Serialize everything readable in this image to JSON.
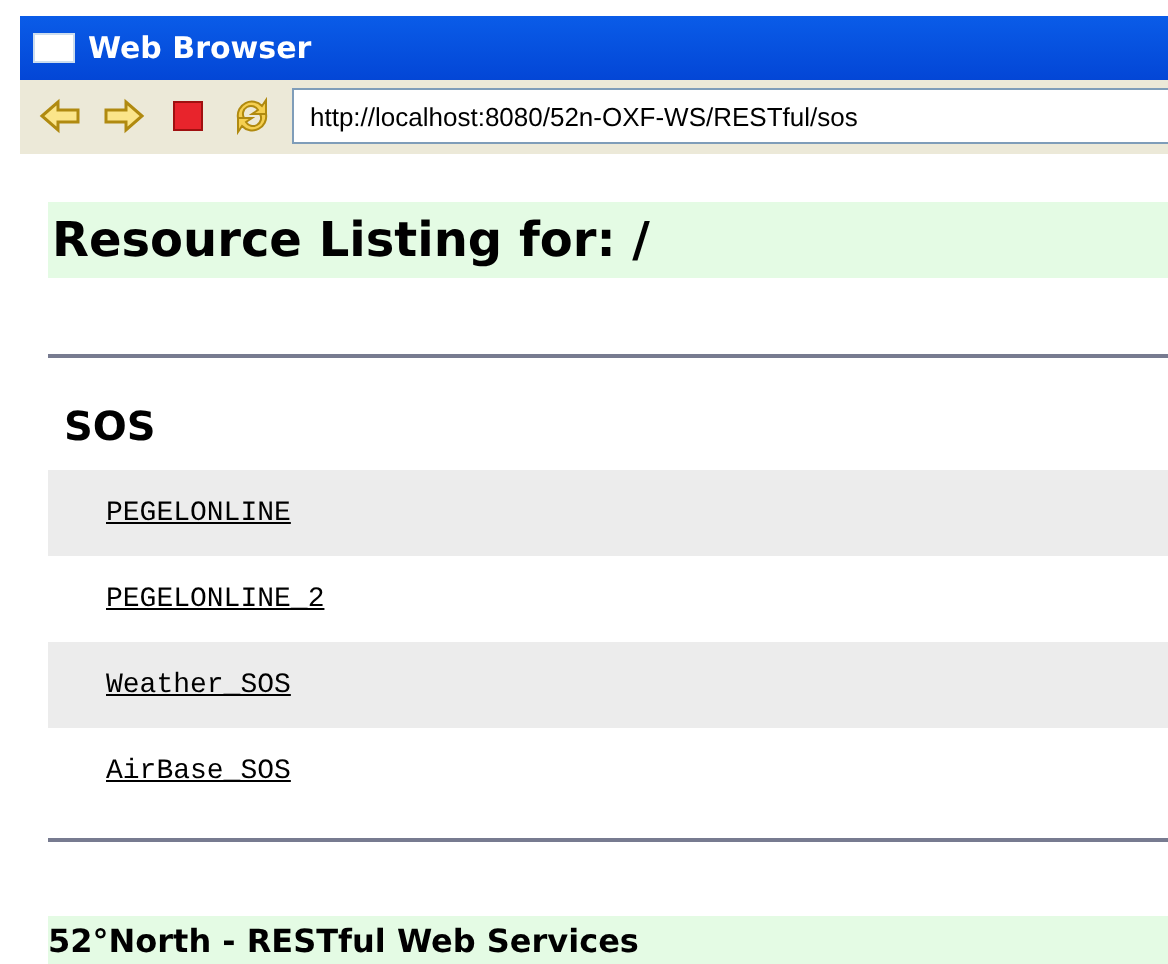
{
  "window": {
    "title": "Web Browser"
  },
  "toolbar": {
    "address": "http://localhost:8080/52n-OXF-WS/RESTful/sos"
  },
  "page": {
    "heading": "Resource Listing for: /",
    "section": "SOS",
    "links": [
      {
        "label": "PEGELONLINE"
      },
      {
        "label": "PEGELONLINE_2"
      },
      {
        "label": "Weather_SOS"
      },
      {
        "label": "AirBase_SOS"
      }
    ],
    "footer": "52°North  -  RESTful Web Services"
  }
}
